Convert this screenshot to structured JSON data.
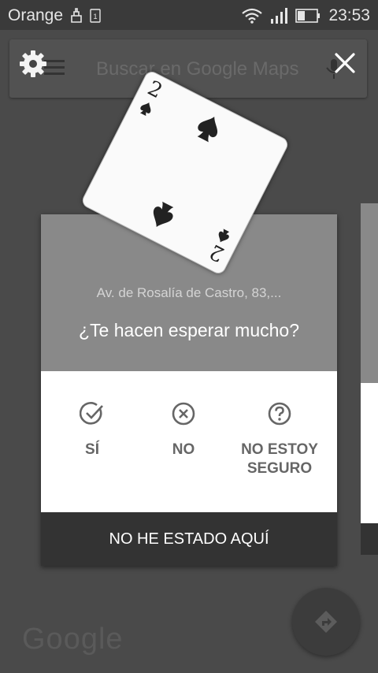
{
  "status_bar": {
    "carrier": "Orange",
    "time": "23:53"
  },
  "search": {
    "placeholder": "Buscar en Google Maps"
  },
  "card": {
    "place_name": "",
    "address": "Av. de Rosalía de Castro, 83,...",
    "question": "¿Te hacen esperar mucho?",
    "options": [
      {
        "label": "SÍ",
        "icon": "check-circle-icon"
      },
      {
        "label": "NO",
        "icon": "x-circle-icon"
      },
      {
        "label": "NO ESTOY SEGURO",
        "icon": "question-circle-icon"
      }
    ],
    "footer_button": "NO HE ESTADO AQUÍ"
  },
  "playing_card": {
    "rank": "2",
    "suit": "spades"
  },
  "map": {
    "logo": "Google"
  }
}
